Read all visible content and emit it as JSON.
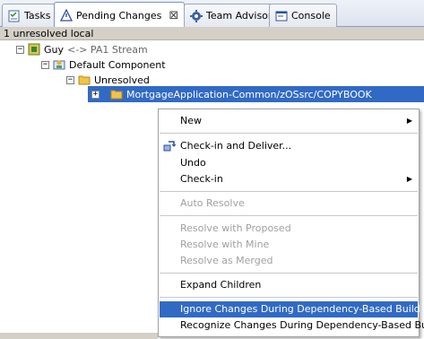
{
  "tabs": [
    {
      "label": "Tasks"
    },
    {
      "label": "Pending Changes",
      "active": true
    },
    {
      "label": "Team Advisor"
    },
    {
      "label": "Console"
    }
  ],
  "status_line": "1 unresolved local",
  "tree": {
    "workspace": {
      "name": "Guy",
      "suffix": "<-> PA1 Stream"
    },
    "component": "Default Component",
    "folder": "Unresolved",
    "selected_item": "MortgageApplication-Common/zOSsrc/COPYBOOK"
  },
  "menu": {
    "new": "New",
    "checkin_deliver": "Check-in and Deliver...",
    "undo": "Undo",
    "checkin": "Check-in",
    "auto_resolve": "Auto Resolve",
    "resolve_proposed": "Resolve with Proposed",
    "resolve_mine": "Resolve with Mine",
    "resolve_merged": "Resolve as Merged",
    "expand_children": "Expand Children",
    "ignore_changes": "Ignore Changes During Dependency-Based Build",
    "recognize_changes": "Recognize Changes During Dependency-Based Build"
  },
  "colors": {
    "selection": "#316ac5",
    "folder": "#f4c24a",
    "menu_disabled": "#a0a0a0"
  }
}
